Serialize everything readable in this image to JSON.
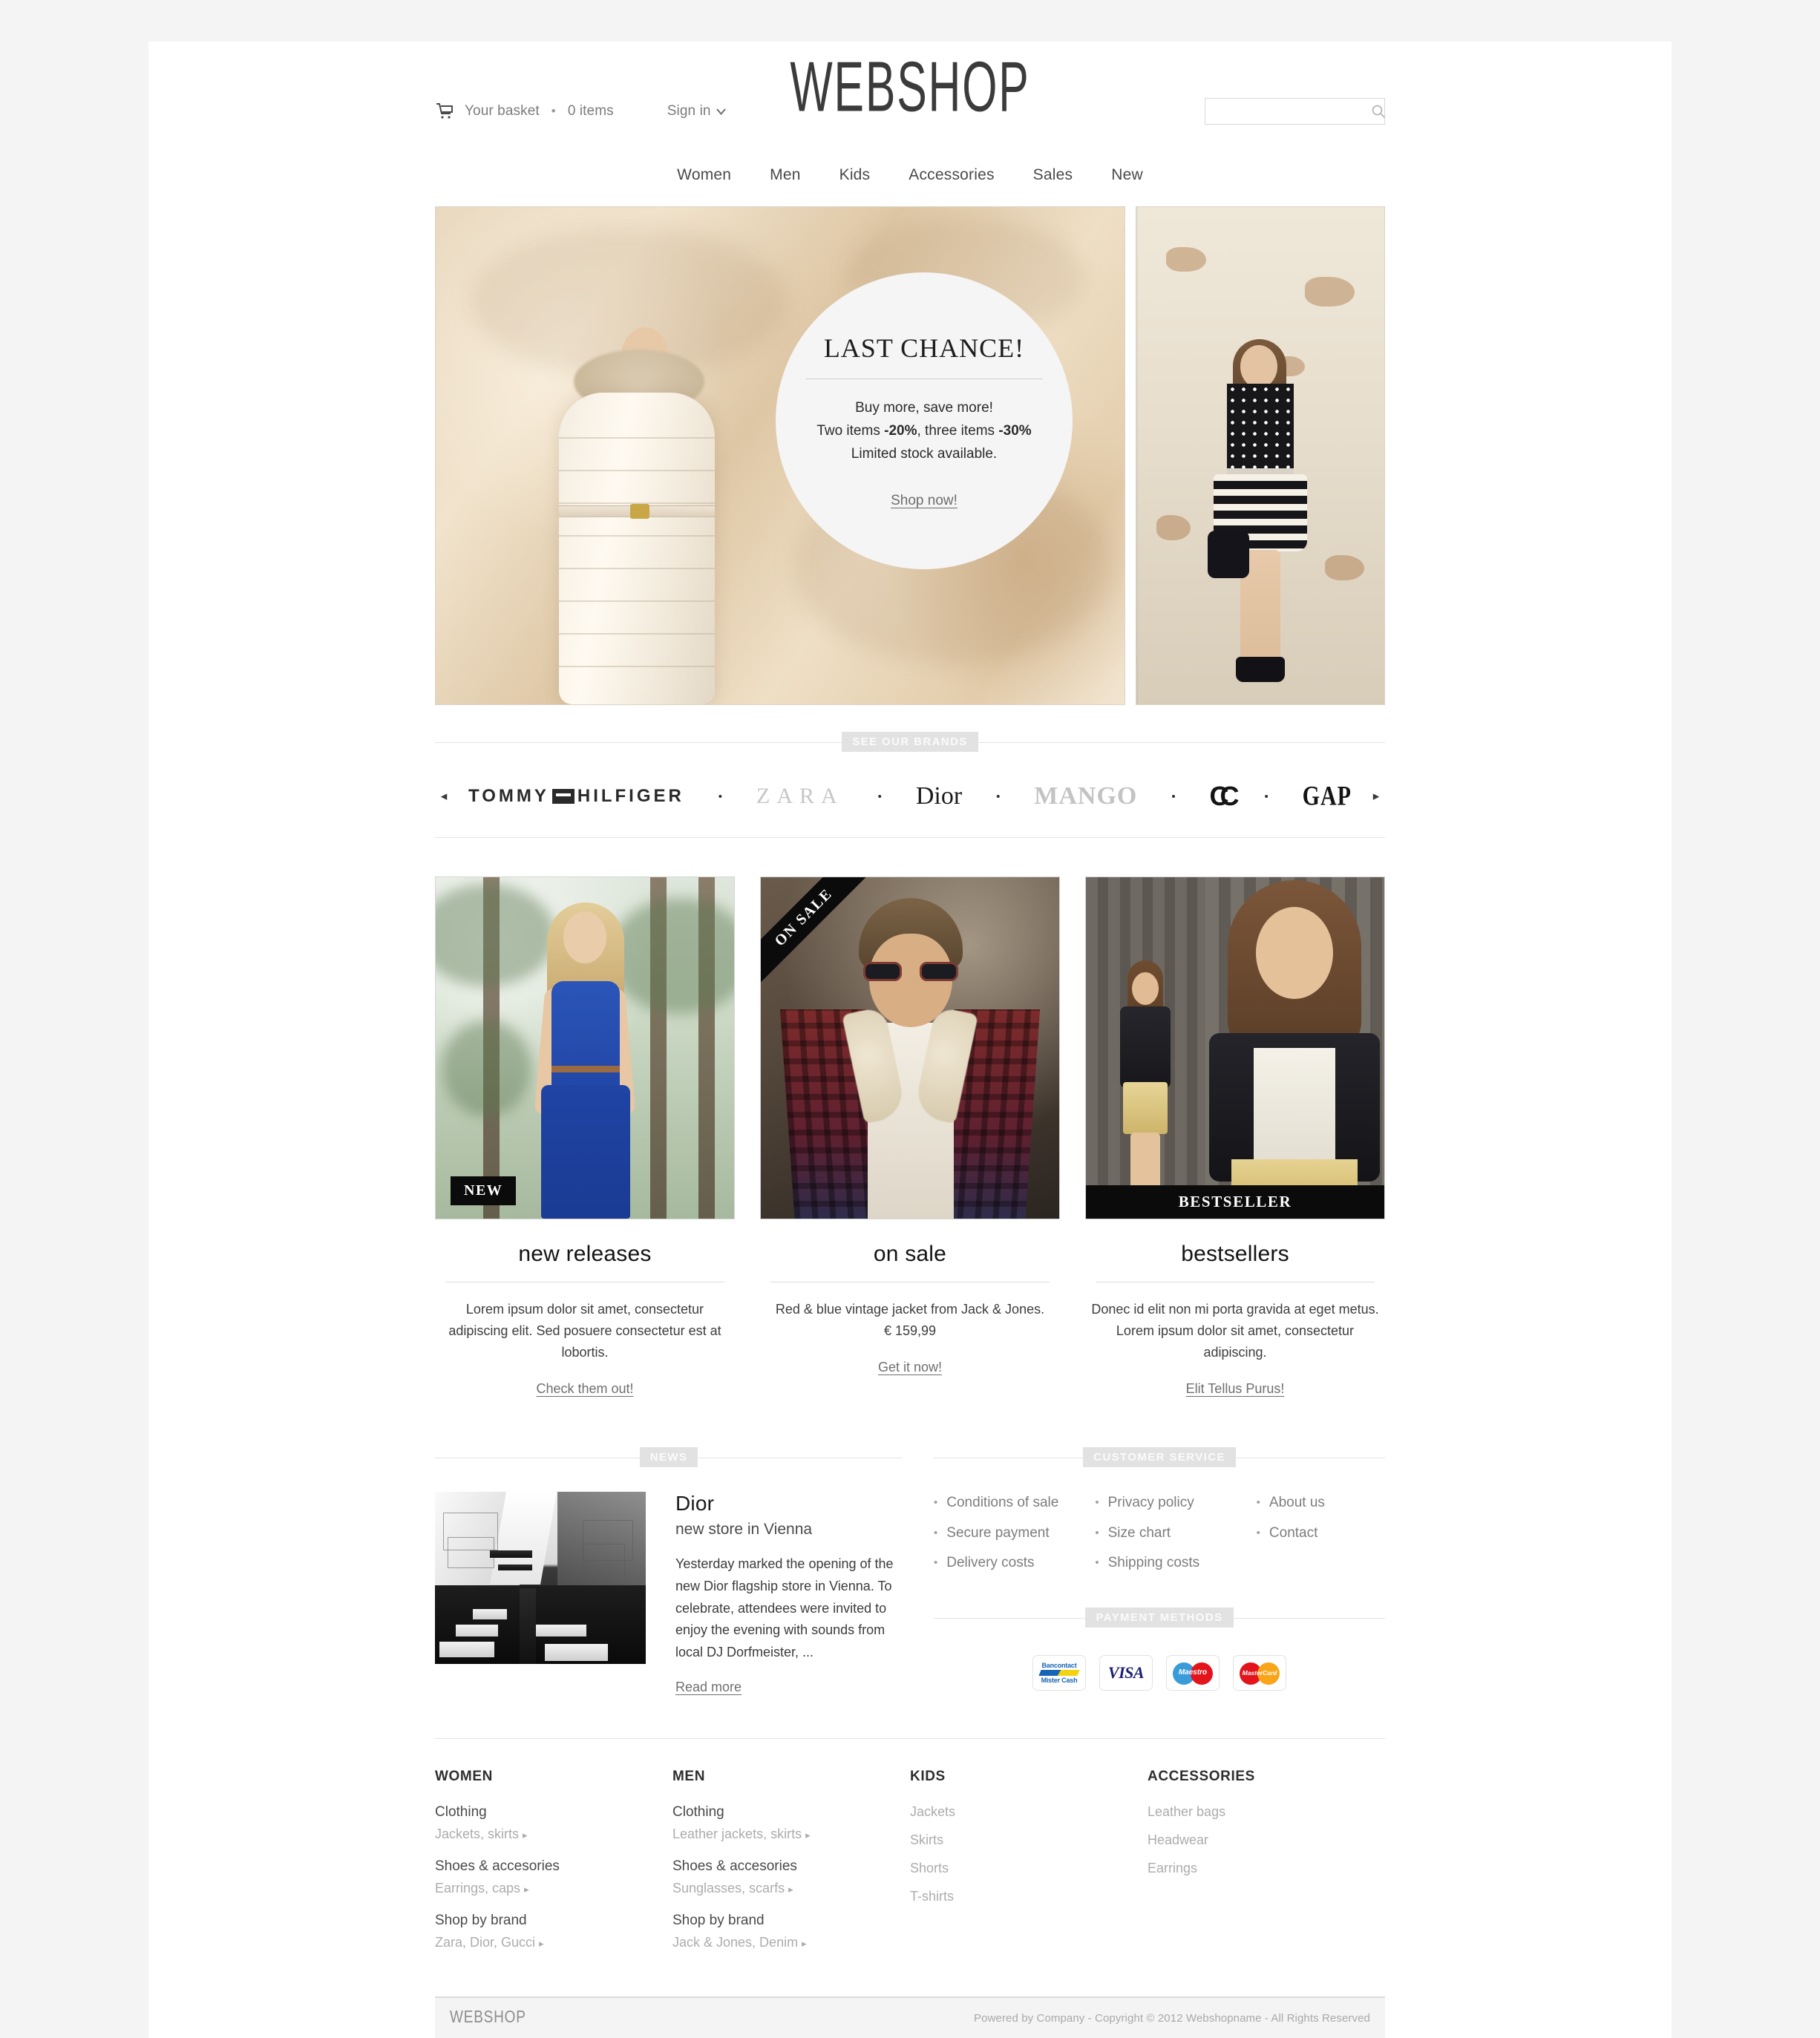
{
  "header": {
    "logo": "WEBSHOP",
    "basket_label": "Your basket",
    "basket_separator": "•",
    "basket_count": "0 items",
    "signin_label": "Sign in",
    "signin_caret": "⌄",
    "search_placeholder": "",
    "search_value": "",
    "search_icon": "search-icon"
  },
  "nav": {
    "items": [
      {
        "label": "Women"
      },
      {
        "label": "Men"
      },
      {
        "label": "Kids"
      },
      {
        "label": "Accessories"
      },
      {
        "label": "Sales"
      },
      {
        "label": "New"
      }
    ]
  },
  "hero": {
    "promo": {
      "title": "LAST CHANCE!",
      "line1": "Buy more, save more!",
      "line2_a": "Two items ",
      "line2_b": "-20%",
      "line2_c": ", three items ",
      "line2_d": "-30%",
      "line3": "Limited stock available.",
      "cta": "Shop now!"
    }
  },
  "brands": {
    "section_label": "SEE OUR BRANDS",
    "prev_arrow": "◂",
    "next_arrow": "▸",
    "dot": "•",
    "items": [
      {
        "name": "TOMMY HILFIGER"
      },
      {
        "name": "ZARA"
      },
      {
        "name": "Dior"
      },
      {
        "name": "MANGO"
      },
      {
        "name": "CHANEL"
      },
      {
        "name": "GAP"
      }
    ]
  },
  "cards": [
    {
      "badge": "NEW",
      "title": "new releases",
      "desc": "Lorem ipsum dolor sit amet, consectetur adipiscing elit. Sed posuere consectetur est at lobortis.",
      "link": "Check them out!"
    },
    {
      "badge": "ON SALE",
      "title": "on sale",
      "desc": "Red & blue vintage jacket from Jack & Jones.",
      "price": "€ 159,99",
      "link": "Get it now!"
    },
    {
      "badge": "BESTSELLER",
      "title": "bestsellers",
      "desc": "Donec id elit non mi porta gravida at eget metus. Lorem ipsum dolor sit amet, consectetur adipiscing.",
      "link": "Elit Tellus Purus!"
    }
  ],
  "news": {
    "section_label": "NEWS",
    "title": "Dior",
    "subtitle": "new store in Vienna",
    "body": "Yesterday marked the opening of the new Dior flagship store in Vienna. To celebrate, attendees were invited to enjoy the evening with sounds from local DJ Dorfmeister, ...",
    "read_more": "Read more"
  },
  "customer_service": {
    "section_label": "CUSTOMER SERVICE",
    "bullet": "•",
    "columns": [
      {
        "items": [
          "Conditions of sale",
          "Secure payment",
          "Delivery costs"
        ]
      },
      {
        "items": [
          "Privacy policy",
          "Size chart",
          "Shipping costs"
        ]
      },
      {
        "items": [
          "About us",
          "Contact"
        ]
      }
    ]
  },
  "payment": {
    "section_label": "PAYMENT METHODS",
    "methods": [
      {
        "name": "Bancontact Mister Cash",
        "line1": "Bancontact",
        "line2": "Mister Cash"
      },
      {
        "name": "VISA",
        "line1": "VISA"
      },
      {
        "name": "Maestro",
        "line1": "Maestro"
      },
      {
        "name": "MasterCard",
        "line1": "MasterCard"
      }
    ]
  },
  "footer_nav": {
    "columns": [
      {
        "head": "WOMEN",
        "groups": [
          {
            "main": "Clothing",
            "sub": "Jackets, skirts",
            "chev": "▸"
          },
          {
            "main": "Shoes & accesories",
            "sub": "Earrings, caps",
            "chev": "▸"
          },
          {
            "main": "Shop by brand",
            "sub": "Zara, Dior, Gucci",
            "chev": "▸"
          }
        ]
      },
      {
        "head": "MEN",
        "groups": [
          {
            "main": "Clothing",
            "sub": "Leather jackets, skirts",
            "chev": "▸"
          },
          {
            "main": "Shoes & accesories",
            "sub": "Sunglasses, scarfs",
            "chev": "▸"
          },
          {
            "main": "Shop by brand",
            "sub": "Jack & Jones, Denim",
            "chev": "▸"
          }
        ]
      },
      {
        "head": "KIDS",
        "flat": [
          "Jackets",
          "Skirts",
          "Shorts",
          "T-shirts"
        ]
      },
      {
        "head": "ACCESSORIES",
        "flat": [
          "Leather bags",
          "Headwear",
          "Earrings"
        ]
      }
    ]
  },
  "bottom_bar": {
    "logo": "WEBSHOP",
    "copyright": "Powered by Company - Copyright © 2012 Webshopname - All Rights Reserved"
  },
  "colors": {
    "page_bg": "#f4f4f4",
    "shell_bg": "#ffffff",
    "chip_bg": "#e2e2e2",
    "badge_bg": "#0b0b0b",
    "text_dark": "#1a1a1a",
    "text_muted": "#7d7d7d"
  }
}
